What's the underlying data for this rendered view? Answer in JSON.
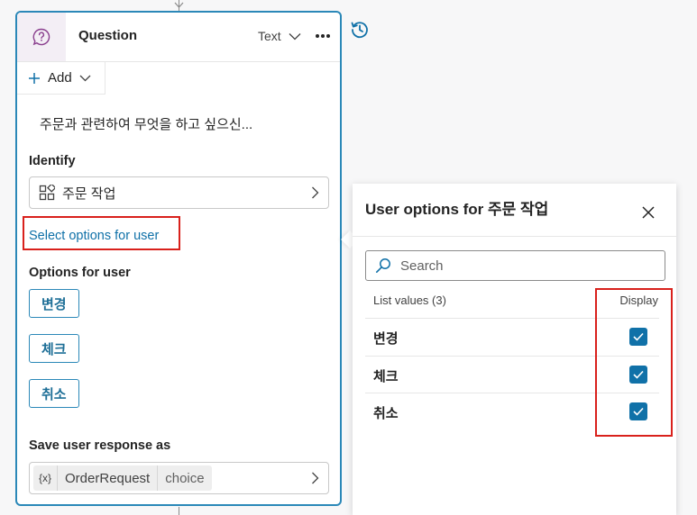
{
  "node": {
    "title": "Question",
    "type_label": "Text",
    "add_label": "Add",
    "message": "주문과 관련하여 무엇을 하고 싶으신...",
    "identify_label": "Identify",
    "identify_value": "주문 작업",
    "select_link": "Select options for user",
    "options_label": "Options for user",
    "options": [
      "변경",
      "체크",
      "취소"
    ],
    "save_label": "Save user response as",
    "variable_icon": "{x}",
    "variable_name": "OrderRequest",
    "variable_type": "choice"
  },
  "panel": {
    "title": "User options for 주문 작업",
    "search_placeholder": "Search",
    "list_header": "List values (3)",
    "display_header": "Display",
    "rows": [
      {
        "value": "변경",
        "display": true
      },
      {
        "value": "체크",
        "display": true
      },
      {
        "value": "취소",
        "display": true
      }
    ]
  },
  "colors": {
    "accent": "#2b88b8",
    "link": "#1071a8",
    "checkbox": "#1071a8",
    "highlight": "#d9211c"
  }
}
